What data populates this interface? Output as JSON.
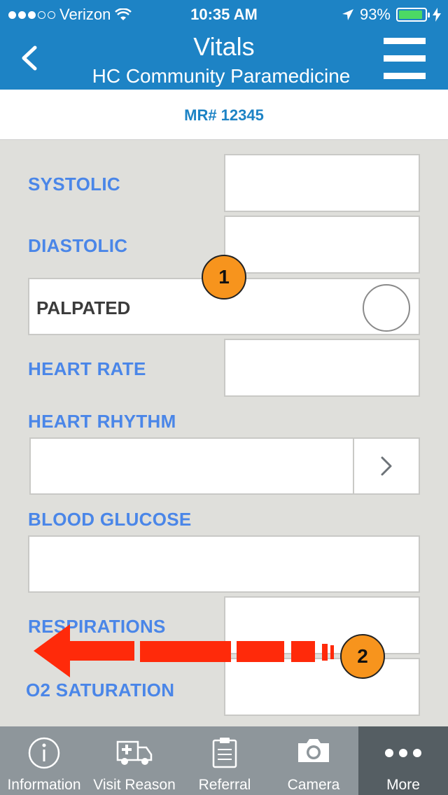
{
  "status_bar": {
    "carrier": "Verizon",
    "time": "10:35 AM",
    "battery": "93%",
    "battery_level": 0.93
  },
  "nav": {
    "title": "Vitals",
    "subtitle": "HC Community Paramedicine",
    "back_icon": "chevron-left-icon",
    "menu_icon": "hamburger-menu-icon"
  },
  "record": {
    "mr_label": "MR# 12345"
  },
  "form": {
    "systolic": {
      "label": "SYSTOLIC",
      "value": ""
    },
    "diastolic": {
      "label": "DIASTOLIC",
      "value": ""
    },
    "palpated": {
      "label": "PALPATED",
      "checked": false
    },
    "heart_rate": {
      "label": "HEART RATE",
      "value": ""
    },
    "heart_rhythm": {
      "label": "HEART RHYTHM",
      "value": ""
    },
    "blood_glucose": {
      "label": "BLOOD GLUCOSE",
      "value": ""
    },
    "respirations": {
      "label": "RESPIRATIONS",
      "value": ""
    },
    "o2_saturation": {
      "label": "O2 SATURATION",
      "value": ""
    }
  },
  "annotations": {
    "badge_1": "1",
    "badge_2": "2",
    "arrow_color": "#ff2a0a"
  },
  "tabs": [
    {
      "label": "Information",
      "icon": "info-icon"
    },
    {
      "label": "Visit Reason",
      "icon": "ambulance-icon"
    },
    {
      "label": "Referral",
      "icon": "clipboard-icon"
    },
    {
      "label": "Camera",
      "icon": "camera-icon"
    },
    {
      "label": "More",
      "icon": "more-dots-icon",
      "active": true
    }
  ],
  "colors": {
    "nav_blue": "#1d83c5",
    "label_blue": "#4a86e8",
    "badge_orange": "#f7941d",
    "tab_bg": "#8e969b",
    "tab_active_bg": "#555e63"
  }
}
